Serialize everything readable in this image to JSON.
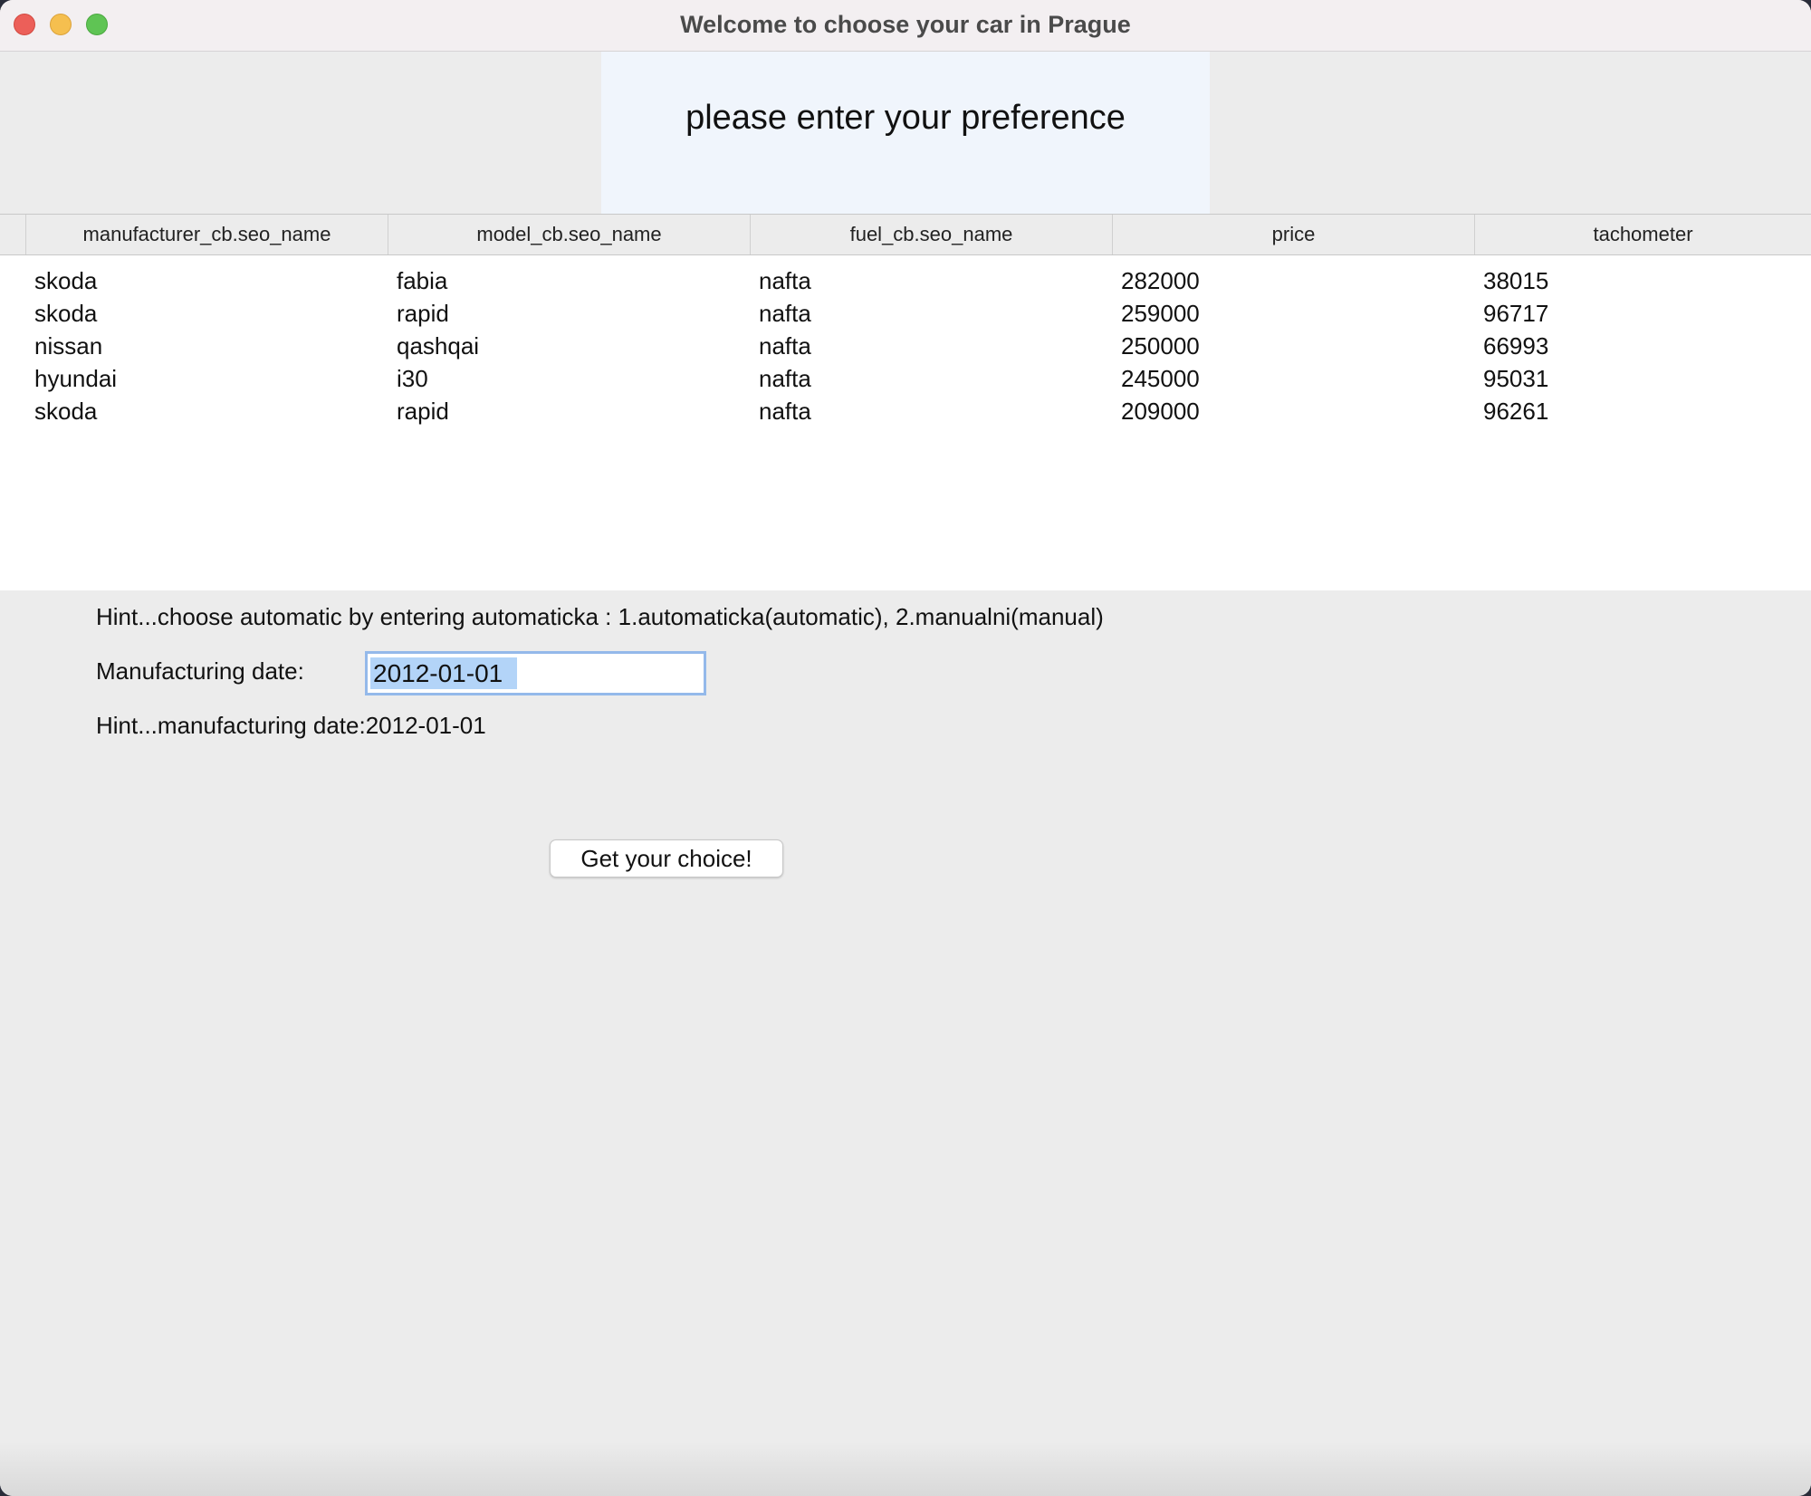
{
  "window": {
    "title": "Welcome to choose your car in Prague"
  },
  "banner": {
    "text": "please enter your preference"
  },
  "table": {
    "columns": [
      "manufacturer_cb.seo_name",
      "model_cb.seo_name",
      "fuel_cb.seo_name",
      "price",
      "tachometer"
    ],
    "rows": [
      [
        "skoda",
        "fabia",
        "nafta",
        "282000",
        "38015"
      ],
      [
        "skoda",
        "rapid",
        "nafta",
        "259000",
        "96717"
      ],
      [
        "nissan",
        "qashqai",
        "nafta",
        "250000",
        "66993"
      ],
      [
        "hyundai",
        "i30",
        "nafta",
        "245000",
        "95031"
      ],
      [
        "skoda",
        "rapid",
        "nafta",
        "209000",
        "96261"
      ]
    ]
  },
  "form": {
    "transmission_hint": "Hint...choose automatic by entering automaticka : 1.automaticka(automatic), 2.manualni(manual)",
    "date_label": "Manufacturing date:",
    "date_value": "2012-01-01",
    "date_hint": "Hint...manufacturing date:2012-01-01",
    "submit_label": "Get your choice!"
  },
  "colors": {
    "close": "#ec5f59",
    "minimize": "#f5bf4f",
    "maximize": "#5fc454",
    "selection": "#b3d4f8",
    "focus_ring": "#94b9ea",
    "banner_bg": "#f0f5fc"
  }
}
